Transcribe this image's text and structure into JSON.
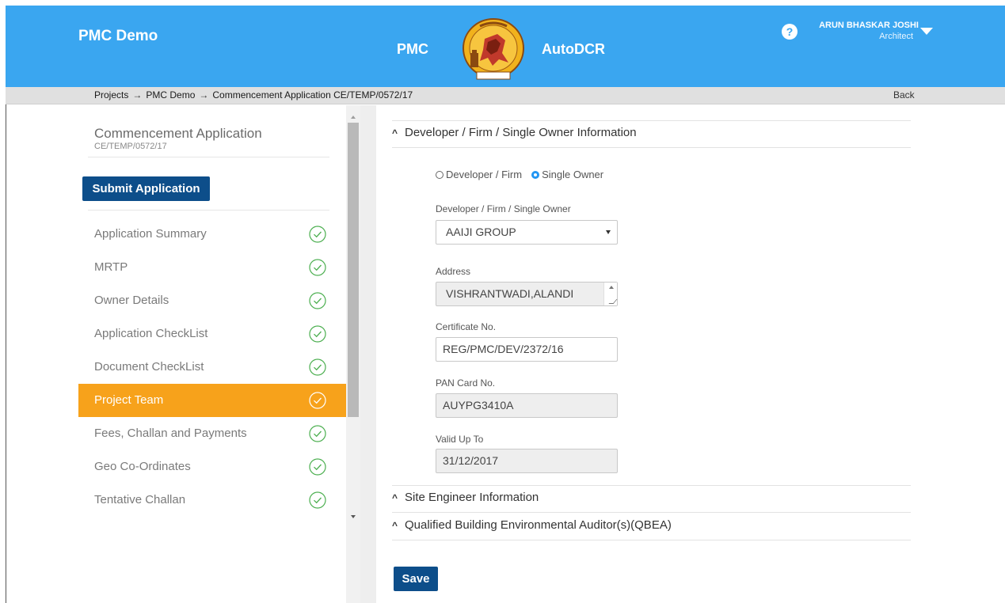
{
  "header": {
    "app_name": "PMC Demo",
    "brand_left": "PMC",
    "brand_right": "AutoDCR",
    "logo_icon": "pmc-emblem-icon",
    "help_glyph": "?",
    "user_name": "ARUN BHASKAR JOSHI",
    "user_role": "Architect",
    "color": "#3aa6f0"
  },
  "breadcrumb": {
    "items": [
      "Projects",
      "PMC Demo",
      "Commencement Application CE/TEMP/0572/17"
    ],
    "separator": "→",
    "back_label": "Back"
  },
  "sidebar": {
    "title": "Commencement Application",
    "subtitle": "CE/TEMP/0572/17",
    "submit_label": "Submit Application",
    "active_index": 5,
    "active_color": "#f7a21b",
    "check_color": "#4caf50",
    "items": [
      {
        "label": "Application Summary",
        "done": true
      },
      {
        "label": "MRTP",
        "done": true
      },
      {
        "label": "Owner Details",
        "done": true
      },
      {
        "label": "Application CheckList",
        "done": true
      },
      {
        "label": "Document CheckList",
        "done": true
      },
      {
        "label": "Project Team",
        "done": true
      },
      {
        "label": "Fees, Challan and Payments",
        "done": true
      },
      {
        "label": "Geo Co-Ordinates",
        "done": true
      },
      {
        "label": "Tentative Challan",
        "done": true
      }
    ]
  },
  "main": {
    "sections": [
      {
        "title": "Developer / Firm / Single Owner Information",
        "expanded": true
      },
      {
        "title": "Site Engineer Information",
        "expanded": false
      },
      {
        "title": "Qualified Building Environmental Auditor(s)(QBEA)",
        "expanded": false
      }
    ],
    "radio_options": [
      {
        "label": "Developer / Firm",
        "checked": false
      },
      {
        "label": "Single Owner",
        "checked": true
      }
    ],
    "fields": {
      "owner": {
        "label": "Developer / Firm / Single Owner",
        "value": "AAIJI GROUP"
      },
      "address": {
        "label": "Address",
        "value": "VISHRANTWADI,ALANDI"
      },
      "certificate": {
        "label": "Certificate No.",
        "value": "REG/PMC/DEV/2372/16"
      },
      "pan": {
        "label": "PAN Card No.",
        "value": "AUYPG3410A"
      },
      "valid": {
        "label": "Valid Up To",
        "value": "31/12/2017"
      }
    },
    "save_label": "Save",
    "button_color": "#0d4e8a"
  }
}
